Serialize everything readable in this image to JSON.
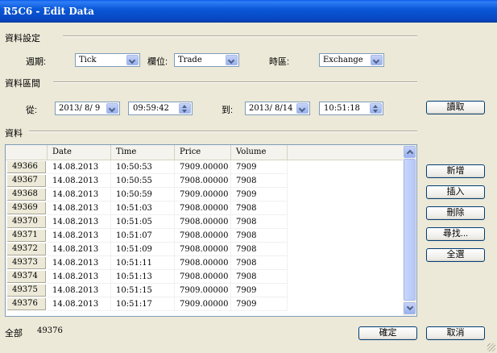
{
  "window": {
    "title": "R5C6 - Edit Data"
  },
  "section_settings": {
    "label": "資料設定",
    "period_label": "週期:",
    "period_value": "Tick",
    "field_label": "欄位:",
    "field_value": "Trade",
    "timezone_label": "時區:",
    "timezone_value": "Exchange"
  },
  "section_range": {
    "label": "資料區間",
    "from_label": "從:",
    "from_date": "2013/ 8/ 9",
    "from_time": "09:59:42",
    "to_label": "到:",
    "to_date": "2013/ 8/14",
    "to_time": "10:51:18",
    "read_button": "讀取"
  },
  "section_data": {
    "label": "資料",
    "columns": [
      "Date",
      "Time",
      "Price",
      "Volume"
    ],
    "rows": [
      {
        "id": "49366",
        "date": "14.08.2013",
        "time": "10:50:53",
        "price": "7909.00000",
        "volume": "7909"
      },
      {
        "id": "49367",
        "date": "14.08.2013",
        "time": "10:50:55",
        "price": "7908.00000",
        "volume": "7908"
      },
      {
        "id": "49368",
        "date": "14.08.2013",
        "time": "10:50:59",
        "price": "7909.00000",
        "volume": "7909"
      },
      {
        "id": "49369",
        "date": "14.08.2013",
        "time": "10:51:03",
        "price": "7908.00000",
        "volume": "7908"
      },
      {
        "id": "49370",
        "date": "14.08.2013",
        "time": "10:51:05",
        "price": "7908.00000",
        "volume": "7908"
      },
      {
        "id": "49371",
        "date": "14.08.2013",
        "time": "10:51:07",
        "price": "7908.00000",
        "volume": "7908"
      },
      {
        "id": "49372",
        "date": "14.08.2013",
        "time": "10:51:09",
        "price": "7908.00000",
        "volume": "7908"
      },
      {
        "id": "49373",
        "date": "14.08.2013",
        "time": "10:51:11",
        "price": "7908.00000",
        "volume": "7908"
      },
      {
        "id": "49374",
        "date": "14.08.2013",
        "time": "10:51:13",
        "price": "7908.00000",
        "volume": "7908"
      },
      {
        "id": "49375",
        "date": "14.08.2013",
        "time": "10:51:15",
        "price": "7909.00000",
        "volume": "7909"
      },
      {
        "id": "49376",
        "date": "14.08.2013",
        "time": "10:51:17",
        "price": "7909.00000",
        "volume": "7909"
      }
    ]
  },
  "side_buttons": {
    "add": "新增",
    "insert": "插入",
    "delete": "刪除",
    "find": "尋找...",
    "select_all": "全選"
  },
  "footer": {
    "total_label": "全部",
    "total_value": "49376",
    "ok_button": "確定",
    "cancel_button": "取消"
  }
}
